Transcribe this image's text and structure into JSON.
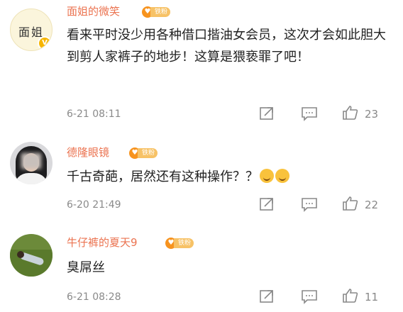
{
  "comments": [
    {
      "avatar_text": "面姐",
      "username": "面姐的微笑",
      "fan_label": "铁粉",
      "text": "看来平时没少用各种借口揩油女会员，这次才会如此胆大到剪人家裤子的地步！这算是猥亵罪了吧！",
      "time": "6-21 08:11",
      "likes": "23"
    },
    {
      "username": "德隆眼镜",
      "fan_label": "铁粉",
      "text": "千古奇葩，居然还有这种操作？？",
      "time": "6-20 21:49",
      "likes": "22"
    },
    {
      "username": "牛仔裤的夏天9",
      "fan_label": "铁粉",
      "text": "臭屌丝",
      "time": "6-21 08:28",
      "likes": "11"
    }
  ],
  "colors": {
    "username": "#eb7350",
    "meta": "#8a8a8a",
    "badge": "#f7931e"
  },
  "icons": [
    "share-icon",
    "comment-icon",
    "like-icon"
  ]
}
